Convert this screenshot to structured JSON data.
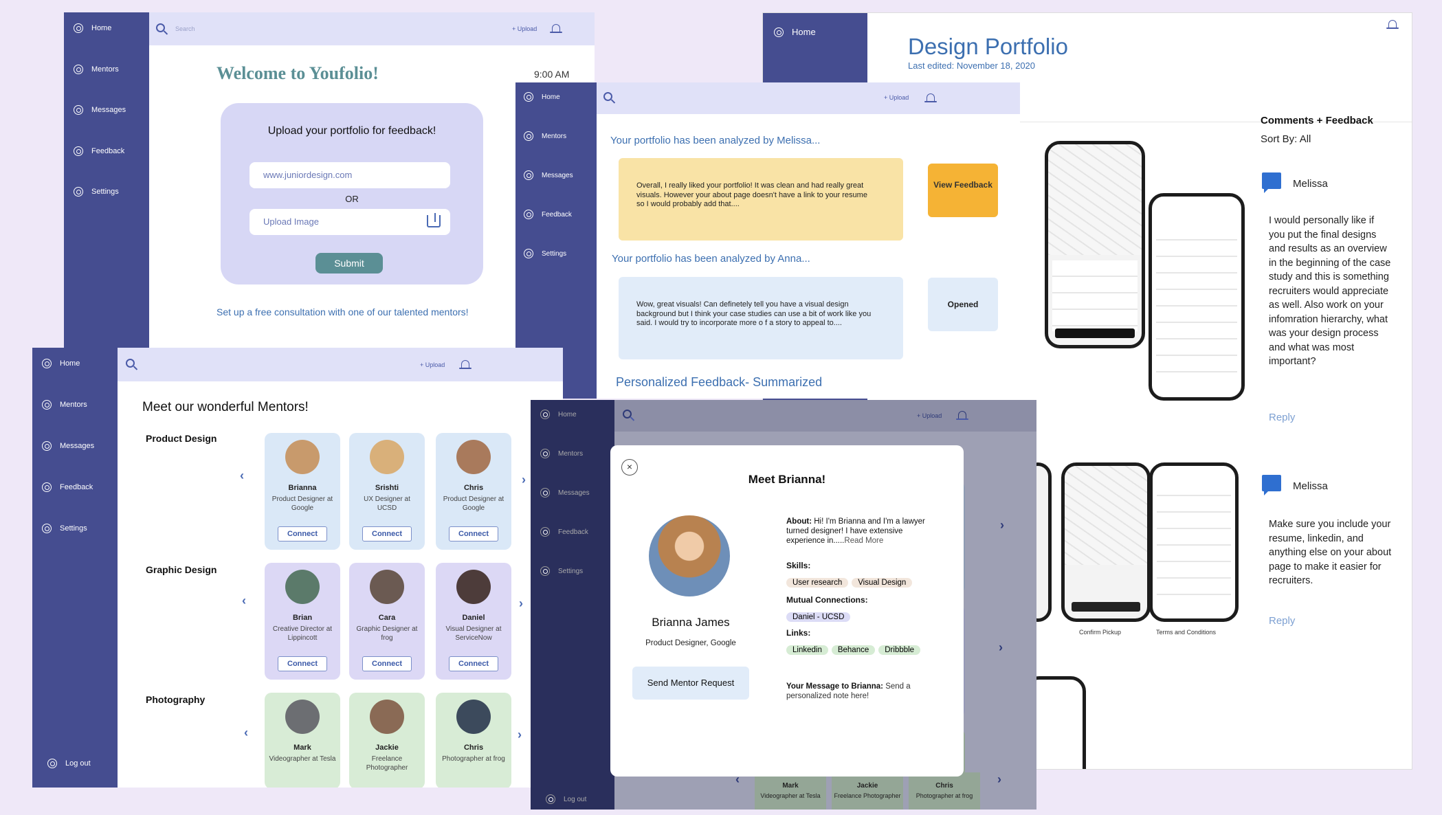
{
  "nav": {
    "home": "Home",
    "mentors": "Mentors",
    "messages": "Messages",
    "feedback": "Feedback",
    "settings": "Settings",
    "logout": "Log out"
  },
  "topbar": {
    "search_placeholder": "Search",
    "upload": "Upload"
  },
  "welcome": {
    "title": "Welcome to Youfolio!",
    "time": "9:00 AM",
    "card_title": "Upload your portfolio for feedback!",
    "url_value": "www.juniordesign.com",
    "or": "OR",
    "upload_image": "Upload Image",
    "submit": "Submit",
    "consult": "Set up a free consultation with one of our talented mentors!"
  },
  "feedback": {
    "h1": "Your portfolio has been analyzed by Melissa...",
    "msg1": "Overall, I really liked your portfolio! It was clean and had really great visuals. However your about page doesn't have a link to your resume so I would probably add that....",
    "btn1": "View Feedback",
    "h2": "Your portfolio has been analyzed by Anna...",
    "msg2": "Wow, great visuals! Can definetely tell you have a visual design background but I think your case studies can use a bit of work like you said. I would try to incorporate more o f a story to appeal to....",
    "btn2": "Opened",
    "h3": "Personalized Feedback- Summarized"
  },
  "portfolio": {
    "title": "Design Portfolio",
    "edited": "Last edited: November 18, 2020",
    "comments_title": "Comments + Feedback",
    "sort": "Sort By: All",
    "c1_name": "Melissa",
    "c1_text": "I would personally like if you put the final designs and results as an overview in the beginning of the case study and this is something recruiters would appreciate as well. Also work on your infomration hierarchy, what was your design process and what was most important?",
    "c2_name": "Melissa",
    "c2_text": "Make sure you include your resume, linkedin, and anything else on your about page to make it easier for recruiters.",
    "reply": "Reply",
    "cap1": "Confirm Pickup",
    "cap2": "Terms and Conditions"
  },
  "mentors": {
    "title": "Meet our wonderful Mentors!",
    "connect": "Connect",
    "categories": [
      {
        "name": "Product Design",
        "people": [
          {
            "name": "Brianna",
            "role": "Product Designer at Google"
          },
          {
            "name": "Srishti",
            "role": "UX Designer at UCSD"
          },
          {
            "name": "Chris",
            "role": "Product Designer at Google"
          }
        ]
      },
      {
        "name": "Graphic Design",
        "people": [
          {
            "name": "Brian",
            "role": "Creative Director at Lippincott"
          },
          {
            "name": "Cara",
            "role": "Graphic Designer at frog"
          },
          {
            "name": "Daniel",
            "role": "Visual Designer at ServiceNow"
          }
        ]
      },
      {
        "name": "Photography",
        "people": [
          {
            "name": "Mark",
            "role": "Videographer at Tesla"
          },
          {
            "name": "Jackie",
            "role": "Freelance Photographer"
          },
          {
            "name": "Chris",
            "role": "Photographer at frog"
          }
        ]
      }
    ]
  },
  "modal": {
    "title": "Meet Brianna!",
    "name": "Brianna James",
    "role": "Product Designer, Google",
    "send": "Send Mentor Request",
    "about_label": "About:",
    "about": "Hi! I'm Brianna and I'm a lawyer turned designer! I have extensive experience in.....",
    "read_more": "Read More",
    "skills_label": "Skills:",
    "skills": [
      "User research",
      "Visual Design"
    ],
    "mutual_label": "Mutual Connections:",
    "mutual": [
      "Daniel - UCSD"
    ],
    "links_label": "Links:",
    "links": [
      "Linkedin",
      "Behance",
      "Dribbble"
    ],
    "message_label": "Your Message to Brianna:",
    "message_hint": "Send a personalized note here!",
    "bg_people": [
      {
        "name": "Mark",
        "role": "Videographer at Tesla"
      },
      {
        "name": "Jackie",
        "role": "Freelance Photographer"
      },
      {
        "name": "Chris",
        "role": "Photographer at frog"
      }
    ]
  },
  "colors": {
    "sidebar": "#454d90",
    "topbar": "#e0e1f8",
    "accent": "#3c6fb0",
    "yellow": "#f9e3a6",
    "orange": "#f5b335"
  }
}
